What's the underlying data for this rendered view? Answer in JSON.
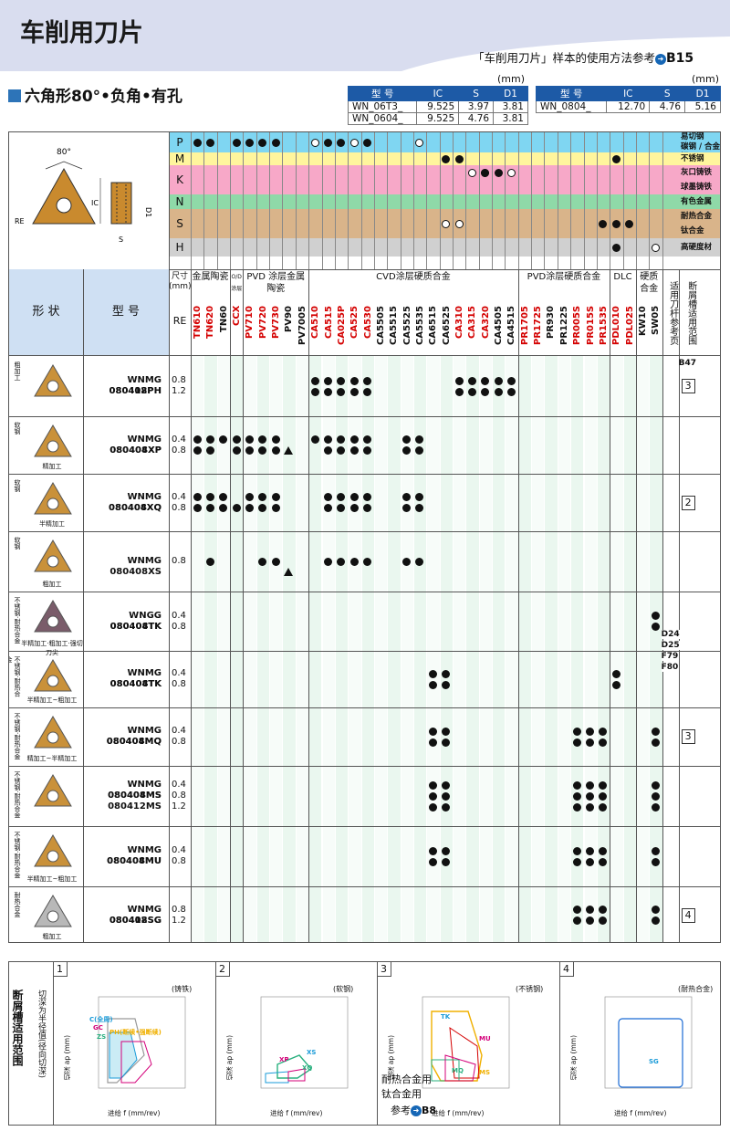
{
  "header": {
    "title": "车削用刀片",
    "ref_text": "「车削用刀片」样本的使用方法参考",
    "ref_page": "B15"
  },
  "subtitle": "六角形80°•负角•有孔",
  "dim_table_unit": "(mm)",
  "dim_table1": {
    "headers": [
      "型 号",
      "IC",
      "S",
      "D1"
    ],
    "rows": [
      [
        "WN_06T3_",
        "9.525",
        "3.97",
        "3.81"
      ],
      [
        "WN_0604_",
        "9.525",
        "4.76",
        "3.81"
      ]
    ]
  },
  "dim_table2": {
    "headers": [
      "型 号",
      "IC",
      "S",
      "D1"
    ],
    "rows": [
      [
        "WN_0804_",
        "12.70",
        "4.76",
        "5.16"
      ]
    ]
  },
  "diagram": {
    "angle": "80°",
    "ic": "IC",
    "d1": "D1",
    "re": "RE",
    "s": "S"
  },
  "materials": [
    {
      "letter": "P",
      "color": "#7fd6f2",
      "labels": [
        "易切钢",
        "碳钢 / 合金钢"
      ]
    },
    {
      "letter": "M",
      "color": "#fff59d",
      "labels": [
        "不锈钢"
      ]
    },
    {
      "letter": "K",
      "color": "#f7a8c8",
      "labels": [
        "灰口铸铁",
        "球墨铸铁"
      ]
    },
    {
      "letter": "N",
      "color": "#8fd9a8",
      "labels": [
        "有色金属"
      ]
    },
    {
      "letter": "S",
      "color": "#d9b48a",
      "labels": [
        "耐热合金",
        "钛合金"
      ]
    },
    {
      "letter": "H",
      "color": "#d0d0d0",
      "labels": [
        "高硬度材"
      ]
    }
  ],
  "col_headers": {
    "shape": "形 状",
    "model": "型 号",
    "size": "尺寸\n(mm)",
    "re": "RE",
    "groups": [
      "金属陶瓷",
      "O/D 涂层",
      "PVD 涂层金属陶瓷",
      "CVD涂层硬质合金",
      "PVD涂层硬质合金",
      "DLC",
      "硬质合金",
      "适用刀杆参考页",
      "断屑槽适用范围"
    ]
  },
  "grades": [
    {
      "name": "TN610",
      "c": "#d40000"
    },
    {
      "name": "TN620",
      "c": "#d40000"
    },
    {
      "name": "TN60",
      "c": "#111"
    },
    {
      "name": "CCX",
      "c": "#d40000"
    },
    {
      "name": "PV710",
      "c": "#d40000"
    },
    {
      "name": "PV720",
      "c": "#d40000"
    },
    {
      "name": "PV730",
      "c": "#d40000"
    },
    {
      "name": "PV90",
      "c": "#111"
    },
    {
      "name": "PV7005",
      "c": "#111"
    },
    {
      "name": "CA510",
      "c": "#d40000"
    },
    {
      "name": "CA515",
      "c": "#d40000"
    },
    {
      "name": "CA025P",
      "c": "#d40000"
    },
    {
      "name": "CA525",
      "c": "#d40000"
    },
    {
      "name": "CA530",
      "c": "#d40000"
    },
    {
      "name": "CA5505",
      "c": "#111"
    },
    {
      "name": "CA5515",
      "c": "#111"
    },
    {
      "name": "CA5525",
      "c": "#111"
    },
    {
      "name": "CA5535",
      "c": "#111"
    },
    {
      "name": "CA6515",
      "c": "#111"
    },
    {
      "name": "CA6525",
      "c": "#111"
    },
    {
      "name": "CA310",
      "c": "#d40000"
    },
    {
      "name": "CA315",
      "c": "#d40000"
    },
    {
      "name": "CA320",
      "c": "#d40000"
    },
    {
      "name": "CA4505",
      "c": "#111"
    },
    {
      "name": "CA4515",
      "c": "#111"
    },
    {
      "name": "PR1705",
      "c": "#d40000"
    },
    {
      "name": "PR1725",
      "c": "#d40000"
    },
    {
      "name": "PR930",
      "c": "#111"
    },
    {
      "name": "PR1225",
      "c": "#111"
    },
    {
      "name": "PR005S",
      "c": "#d40000"
    },
    {
      "name": "PR015S",
      "c": "#d40000"
    },
    {
      "name": "PR1535",
      "c": "#d40000"
    },
    {
      "name": "PDL010",
      "c": "#d40000"
    },
    {
      "name": "PDL025",
      "c": "#d40000"
    },
    {
      "name": "KW10",
      "c": "#111"
    },
    {
      "name": "SW05",
      "c": "#111"
    }
  ],
  "products": [
    {
      "side": "粗加工",
      "cap": "",
      "models": [
        "WNMG 080408PH",
        "080412PH"
      ],
      "re": [
        "0.8",
        "1.2"
      ],
      "range": "3"
    },
    {
      "side": "软钢",
      "cap": "精加工",
      "models": [
        "WNMG 080404XP",
        "080408XP"
      ],
      "re": [
        "0.4",
        "0.8"
      ],
      "range": ""
    },
    {
      "side": "软钢",
      "cap": "半精加工",
      "models": [
        "WNMG 080404XQ",
        "080408XQ"
      ],
      "re": [
        "0.4",
        "0.8"
      ],
      "range": "2"
    },
    {
      "side": "软钢",
      "cap": "粗加工",
      "models": [
        "WNMG 080408XS"
      ],
      "re": [
        "0.8"
      ],
      "range": ""
    },
    {
      "side": "不锈钢·耐热合金",
      "cap": "半精加工·粗加工·强切刀尖",
      "models": [
        "WNGG 080404TK",
        "080408TK"
      ],
      "re": [
        "0.4",
        "0.8"
      ],
      "range": ""
    },
    {
      "side": "不锈钢·耐热合金",
      "cap": "半精加工~粗加工",
      "models": [
        "WNMG 080404TK",
        "080408TK"
      ],
      "re": [
        "0.4",
        "0.8"
      ],
      "range": ""
    },
    {
      "side": "不锈钢·耐热合金",
      "cap": "精加工~半精加工",
      "models": [
        "WNMG 080404MQ",
        "080408MQ"
      ],
      "re": [
        "0.4",
        "0.8"
      ],
      "range": "3"
    },
    {
      "side": "不锈钢·耐热合金",
      "cap": "",
      "models": [
        "WNMG 080404MS",
        "080408MS",
        "080412MS"
      ],
      "re": [
        "0.4",
        "0.8",
        "1.2"
      ],
      "range": ""
    },
    {
      "side": "不锈钢·耐热合金",
      "cap": "半精加工~粗加工",
      "models": [
        "WNMG 080404MU",
        "080408MU"
      ],
      "re": [
        "0.4",
        "0.8"
      ],
      "range": ""
    },
    {
      "side": "耐热合金",
      "cap": "粗加工",
      "models": [
        "WNMG 080408SG",
        "080412SG"
      ],
      "re": [
        "0.8",
        "1.2"
      ],
      "range": "4"
    }
  ],
  "holder_ref": {
    "b47": "B47",
    "list": [
      "D24",
      "D25",
      "F79",
      "F80"
    ]
  },
  "bottom": {
    "title": "断屑槽适用范围",
    "axis_note": "切深为半径值(径向切深)",
    "panels": [
      {
        "num": "1",
        "type": "(铸铁)",
        "labels": [
          "C(全周)",
          "GC",
          "ZS",
          "PH(断续•强断续)"
        ]
      },
      {
        "num": "2",
        "type": "(软钢)",
        "labels": [
          "XS",
          "XP",
          "XQ"
        ]
      },
      {
        "num": "3",
        "type": "(不锈钢)",
        "labels": [
          "TK",
          "MU",
          "MQ",
          "MS"
        ]
      },
      {
        "num": "4",
        "type": "(耐热合金)",
        "labels": [
          "SG"
        ]
      }
    ],
    "ylabel": "切深 ap (mm)",
    "xlabel": "进给 f (mm/rev)",
    "ref_text1": "耐热合金用",
    "ref_text2": "钛合金用",
    "ref_text3": "参考",
    "ref_page": "B8"
  }
}
